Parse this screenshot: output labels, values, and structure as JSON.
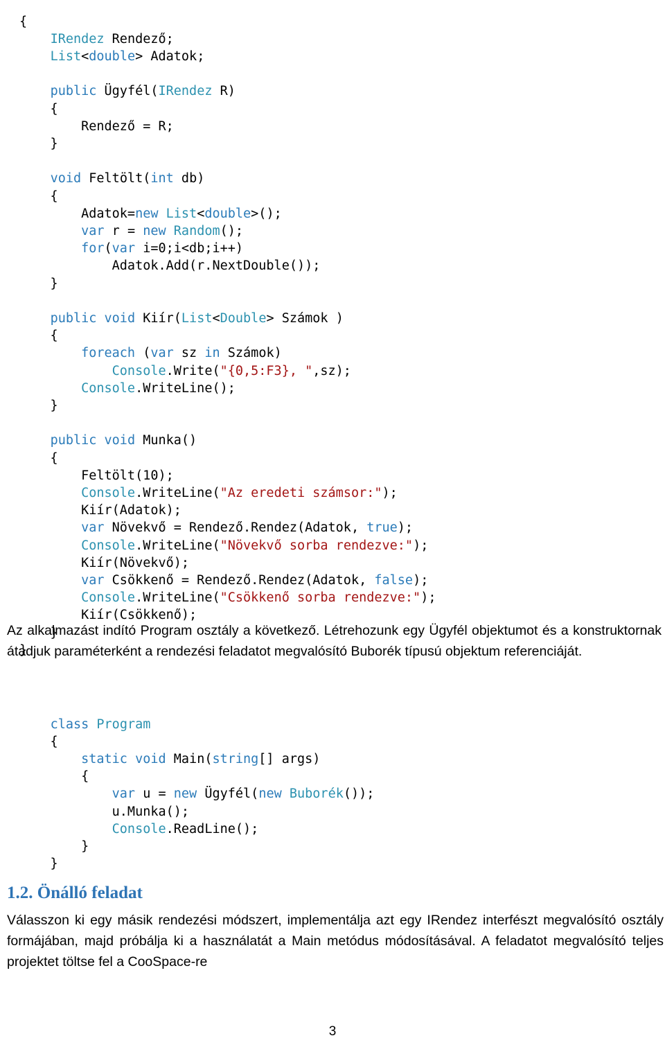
{
  "document": {
    "page_number": "3",
    "code_block_1": {
      "lines": [
        [
          {
            "t": "{",
            "c": "id"
          }
        ],
        [
          {
            "t": "    ",
            "c": "id"
          },
          {
            "t": "IRendez",
            "c": "type"
          },
          {
            "t": " Rendező;",
            "c": "id"
          }
        ],
        [
          {
            "t": "    ",
            "c": "id"
          },
          {
            "t": "List",
            "c": "type"
          },
          {
            "t": "<",
            "c": "id"
          },
          {
            "t": "double",
            "c": "kw"
          },
          {
            "t": "> Adatok;",
            "c": "id"
          }
        ],
        [
          {
            "t": "",
            "c": "id"
          }
        ],
        [
          {
            "t": "    ",
            "c": "id"
          },
          {
            "t": "public",
            "c": "kw"
          },
          {
            "t": " Ügyfél(",
            "c": "id"
          },
          {
            "t": "IRendez",
            "c": "type"
          },
          {
            "t": " R)",
            "c": "id"
          }
        ],
        [
          {
            "t": "    {",
            "c": "id"
          }
        ],
        [
          {
            "t": "        Rendező = R;",
            "c": "id"
          }
        ],
        [
          {
            "t": "    }",
            "c": "id"
          }
        ],
        [
          {
            "t": "",
            "c": "id"
          }
        ],
        [
          {
            "t": "    ",
            "c": "id"
          },
          {
            "t": "void",
            "c": "kw"
          },
          {
            "t": " Feltölt(",
            "c": "id"
          },
          {
            "t": "int",
            "c": "kw"
          },
          {
            "t": " db)",
            "c": "id"
          }
        ],
        [
          {
            "t": "    {",
            "c": "id"
          }
        ],
        [
          {
            "t": "        Adatok=",
            "c": "id"
          },
          {
            "t": "new",
            "c": "kw"
          },
          {
            "t": " ",
            "c": "id"
          },
          {
            "t": "List",
            "c": "type"
          },
          {
            "t": "<",
            "c": "id"
          },
          {
            "t": "double",
            "c": "kw"
          },
          {
            "t": ">();",
            "c": "id"
          }
        ],
        [
          {
            "t": "        ",
            "c": "id"
          },
          {
            "t": "var",
            "c": "kw"
          },
          {
            "t": " r = ",
            "c": "id"
          },
          {
            "t": "new",
            "c": "kw"
          },
          {
            "t": " ",
            "c": "id"
          },
          {
            "t": "Random",
            "c": "type"
          },
          {
            "t": "();",
            "c": "id"
          }
        ],
        [
          {
            "t": "        ",
            "c": "id"
          },
          {
            "t": "for",
            "c": "kw"
          },
          {
            "t": "(",
            "c": "id"
          },
          {
            "t": "var",
            "c": "kw"
          },
          {
            "t": " i=0;i<db;i++)",
            "c": "id"
          }
        ],
        [
          {
            "t": "            Adatok.Add(r.NextDouble());",
            "c": "id"
          }
        ],
        [
          {
            "t": "    }",
            "c": "id"
          }
        ],
        [
          {
            "t": "",
            "c": "id"
          }
        ],
        [
          {
            "t": "    ",
            "c": "id"
          },
          {
            "t": "public",
            "c": "kw"
          },
          {
            "t": " ",
            "c": "id"
          },
          {
            "t": "void",
            "c": "kw"
          },
          {
            "t": " Kiír(",
            "c": "id"
          },
          {
            "t": "List",
            "c": "type"
          },
          {
            "t": "<",
            "c": "id"
          },
          {
            "t": "Double",
            "c": "type"
          },
          {
            "t": "> Számok )",
            "c": "id"
          }
        ],
        [
          {
            "t": "    {",
            "c": "id"
          }
        ],
        [
          {
            "t": "        ",
            "c": "id"
          },
          {
            "t": "foreach",
            "c": "kw"
          },
          {
            "t": " (",
            "c": "id"
          },
          {
            "t": "var",
            "c": "kw"
          },
          {
            "t": " sz ",
            "c": "id"
          },
          {
            "t": "in",
            "c": "kw"
          },
          {
            "t": " Számok)",
            "c": "id"
          }
        ],
        [
          {
            "t": "            ",
            "c": "id"
          },
          {
            "t": "Console",
            "c": "type"
          },
          {
            "t": ".Write(",
            "c": "id"
          },
          {
            "t": "\"{0,5:F3}, \"",
            "c": "str"
          },
          {
            "t": ",sz);",
            "c": "id"
          }
        ],
        [
          {
            "t": "        ",
            "c": "id"
          },
          {
            "t": "Console",
            "c": "type"
          },
          {
            "t": ".WriteLine();",
            "c": "id"
          }
        ],
        [
          {
            "t": "    }",
            "c": "id"
          }
        ],
        [
          {
            "t": "",
            "c": "id"
          }
        ],
        [
          {
            "t": "    ",
            "c": "id"
          },
          {
            "t": "public",
            "c": "kw"
          },
          {
            "t": " ",
            "c": "id"
          },
          {
            "t": "void",
            "c": "kw"
          },
          {
            "t": " Munka()",
            "c": "id"
          }
        ],
        [
          {
            "t": "    {",
            "c": "id"
          }
        ],
        [
          {
            "t": "        Feltölt(10);",
            "c": "id"
          }
        ],
        [
          {
            "t": "        ",
            "c": "id"
          },
          {
            "t": "Console",
            "c": "type"
          },
          {
            "t": ".WriteLine(",
            "c": "id"
          },
          {
            "t": "\"Az eredeti számsor:\"",
            "c": "str"
          },
          {
            "t": ");",
            "c": "id"
          }
        ],
        [
          {
            "t": "        Kiír(Adatok);",
            "c": "id"
          }
        ],
        [
          {
            "t": "        ",
            "c": "id"
          },
          {
            "t": "var",
            "c": "kw"
          },
          {
            "t": " Növekvő = Rendező.Rendez(Adatok, ",
            "c": "id"
          },
          {
            "t": "true",
            "c": "kw"
          },
          {
            "t": ");",
            "c": "id"
          }
        ],
        [
          {
            "t": "        ",
            "c": "id"
          },
          {
            "t": "Console",
            "c": "type"
          },
          {
            "t": ".WriteLine(",
            "c": "id"
          },
          {
            "t": "\"Növekvő sorba rendezve:\"",
            "c": "str"
          },
          {
            "t": ");",
            "c": "id"
          }
        ],
        [
          {
            "t": "        Kiír(Növekvő);",
            "c": "id"
          }
        ],
        [
          {
            "t": "        ",
            "c": "id"
          },
          {
            "t": "var",
            "c": "kw"
          },
          {
            "t": " Csökkenő = Rendező.Rendez(Adatok, ",
            "c": "id"
          },
          {
            "t": "false",
            "c": "kw"
          },
          {
            "t": ");",
            "c": "id"
          }
        ],
        [
          {
            "t": "        ",
            "c": "id"
          },
          {
            "t": "Console",
            "c": "type"
          },
          {
            "t": ".WriteLine(",
            "c": "id"
          },
          {
            "t": "\"Csökkenő sorba rendezve:\"",
            "c": "str"
          },
          {
            "t": ");",
            "c": "id"
          }
        ],
        [
          {
            "t": "        Kiír(Csökkenő);",
            "c": "id"
          }
        ],
        [
          {
            "t": "    }",
            "c": "id"
          }
        ],
        [
          {
            "t": "}",
            "c": "id"
          }
        ]
      ]
    },
    "paragraph_1": "Az alkalmazást indító Program osztály a következő. Létrehozunk egy Ügyfél objektumot és a konstruktornak átadjuk paraméterként a rendezési feladatot megvalósító Buborék típusú objektum referenciáját.",
    "code_block_2": {
      "lines": [
        [
          {
            "t": "    ",
            "c": "id"
          },
          {
            "t": "class",
            "c": "kw"
          },
          {
            "t": " ",
            "c": "id"
          },
          {
            "t": "Program",
            "c": "type"
          }
        ],
        [
          {
            "t": "    {",
            "c": "id"
          }
        ],
        [
          {
            "t": "        ",
            "c": "id"
          },
          {
            "t": "static",
            "c": "kw"
          },
          {
            "t": " ",
            "c": "id"
          },
          {
            "t": "void",
            "c": "kw"
          },
          {
            "t": " Main(",
            "c": "id"
          },
          {
            "t": "string",
            "c": "kw"
          },
          {
            "t": "[] args)",
            "c": "id"
          }
        ],
        [
          {
            "t": "        {",
            "c": "id"
          }
        ],
        [
          {
            "t": "            ",
            "c": "id"
          },
          {
            "t": "var",
            "c": "kw"
          },
          {
            "t": " u = ",
            "c": "id"
          },
          {
            "t": "new",
            "c": "kw"
          },
          {
            "t": " Ügyfél(",
            "c": "id"
          },
          {
            "t": "new",
            "c": "kw"
          },
          {
            "t": " ",
            "c": "id"
          },
          {
            "t": "Buborék",
            "c": "type"
          },
          {
            "t": "());",
            "c": "id"
          }
        ],
        [
          {
            "t": "            u.Munka();",
            "c": "id"
          }
        ],
        [
          {
            "t": "            ",
            "c": "id"
          },
          {
            "t": "Console",
            "c": "type"
          },
          {
            "t": ".ReadLine();",
            "c": "id"
          }
        ],
        [
          {
            "t": "        }",
            "c": "id"
          }
        ],
        [
          {
            "t": "    }",
            "c": "id"
          }
        ]
      ]
    },
    "heading_1_2": "1.2. Önálló feladat",
    "paragraph_2": "Válasszon ki egy másik rendezési módszert, implementálja azt egy IRendez interfészt megvalósító osztály formájában, majd próbálja ki a használatát a Main metódus módosításával. A feladatot megvalósító teljes projektet töltse fel a CooSpace-re",
    "colors": {
      "keyword": "#2b7bb9",
      "type": "#2b91af",
      "string": "#a31515",
      "heading": "#2e74b5",
      "text": "#000000"
    }
  }
}
